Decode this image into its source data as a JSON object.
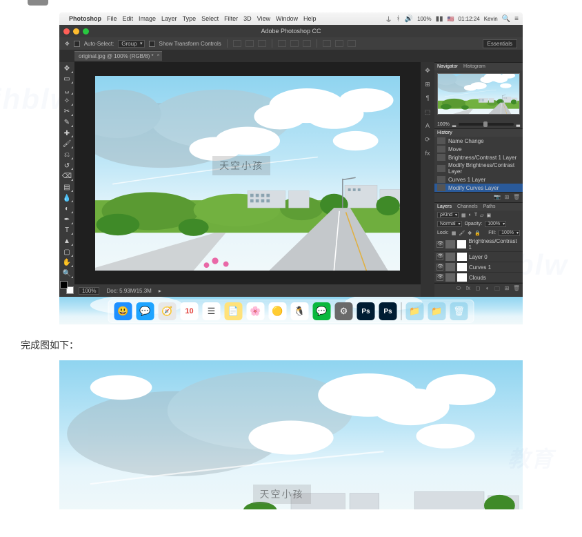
{
  "mac_menubar": {
    "apple": "",
    "app_name": "Photoshop",
    "menus": [
      "File",
      "Edit",
      "Image",
      "Layer",
      "Type",
      "Select",
      "Filter",
      "3D",
      "View",
      "Window",
      "Help"
    ],
    "battery": "100%",
    "flag": "🇺🇸",
    "time": "01:12:24",
    "user": "Kevin"
  },
  "window": {
    "title": "Adobe Photoshop CC"
  },
  "options_bar": {
    "auto_select_label": "Auto-Select:",
    "auto_select_mode": "Group",
    "show_transform_label": "Show Transform Controls",
    "workspace_btn": "Essentials"
  },
  "document_tab": {
    "label": "original.jpg @ 100% (RGB/8) *"
  },
  "tools": [
    {
      "name": "move-tool",
      "glyph": "✥"
    },
    {
      "name": "marquee-tool",
      "glyph": "▭"
    },
    {
      "name": "lasso-tool",
      "glyph": "␣"
    },
    {
      "name": "magic-wand-tool",
      "glyph": "✧"
    },
    {
      "name": "crop-tool",
      "glyph": "✂"
    },
    {
      "name": "eyedropper-tool",
      "glyph": "✎"
    },
    {
      "name": "healing-brush-tool",
      "glyph": "✚"
    },
    {
      "name": "brush-tool",
      "glyph": "🖌"
    },
    {
      "name": "clone-stamp-tool",
      "glyph": "⎌"
    },
    {
      "name": "history-brush-tool",
      "glyph": "↺"
    },
    {
      "name": "eraser-tool",
      "glyph": "⌫"
    },
    {
      "name": "gradient-tool",
      "glyph": "▤"
    },
    {
      "name": "blur-tool",
      "glyph": "💧"
    },
    {
      "name": "dodge-tool",
      "glyph": "◐"
    },
    {
      "name": "pen-tool",
      "glyph": "✒"
    },
    {
      "name": "type-tool",
      "glyph": "T"
    },
    {
      "name": "path-selection-tool",
      "glyph": "▲"
    },
    {
      "name": "rectangle-tool",
      "glyph": "▢"
    },
    {
      "name": "hand-tool",
      "glyph": "✋"
    },
    {
      "name": "zoom-tool",
      "glyph": "🔍"
    }
  ],
  "canvas_watermark": "天空小孩",
  "canvas_status": {
    "zoom": "100%",
    "doc_info": "Doc: 5.93M/15.3M"
  },
  "panel_tabs_right": [
    "✥",
    "⊞",
    "¶",
    "⬚",
    "A",
    "⟳",
    "fx"
  ],
  "navigator": {
    "tabs": [
      "Navigator",
      "Histogram"
    ],
    "zoom": "100%"
  },
  "history": {
    "tab": "History",
    "items": [
      {
        "label": "Name Change",
        "selected": false
      },
      {
        "label": "Move",
        "selected": false
      },
      {
        "label": "Brightness/Contrast 1 Layer",
        "selected": false
      },
      {
        "label": "Modify Brightness/Contrast Layer",
        "selected": false
      },
      {
        "label": "Curves 1 Layer",
        "selected": false
      },
      {
        "label": "Modify Curves Layer",
        "selected": true
      }
    ]
  },
  "layers": {
    "tabs": [
      "Layers",
      "Channels",
      "Paths"
    ],
    "kind_label": "ρKind",
    "blend_mode": "Normal",
    "opacity_label": "Opacity:",
    "opacity_value": "100%",
    "lock_label": "Lock:",
    "fill_label": "Fill:",
    "fill_value": "100%",
    "items": [
      {
        "name": "Brightness/Contrast 1"
      },
      {
        "name": "Layer 0"
      },
      {
        "name": "Curves 1"
      },
      {
        "name": "Clouds"
      }
    ]
  },
  "dock": {
    "apps": [
      {
        "name": "finder",
        "color": "#1e90ff",
        "glyph": "😃"
      },
      {
        "name": "messages",
        "color": "#1ea4ff",
        "glyph": "💬"
      },
      {
        "name": "safari",
        "color": "#e8e8e8",
        "glyph": "🧭"
      },
      {
        "name": "calendar",
        "color": "#fff",
        "glyph": "10"
      },
      {
        "name": "reminders",
        "color": "#fff",
        "glyph": "☰"
      },
      {
        "name": "notes",
        "color": "#ffe27a",
        "glyph": "📄"
      },
      {
        "name": "photos",
        "color": "#fff",
        "glyph": "🌸"
      },
      {
        "name": "chrome",
        "color": "#fff",
        "glyph": "🟡"
      },
      {
        "name": "qq",
        "color": "#fff",
        "glyph": "🐧"
      },
      {
        "name": "wechat",
        "color": "#09b83e",
        "glyph": "💬"
      },
      {
        "name": "settings",
        "color": "#6a6a6a",
        "glyph": "⚙"
      },
      {
        "name": "photoshop",
        "color": "#001d33",
        "glyph": "Ps"
      },
      {
        "name": "photoshop2",
        "color": "#001d33",
        "glyph": "Ps"
      }
    ],
    "right": [
      {
        "name": "folder1",
        "glyph": "📁"
      },
      {
        "name": "folder2",
        "glyph": "📁"
      },
      {
        "name": "trash",
        "glyph": "🗑"
      }
    ]
  },
  "article": {
    "completion_label": "完成图如下："
  },
  "page_bg_watermark": "jhblw"
}
